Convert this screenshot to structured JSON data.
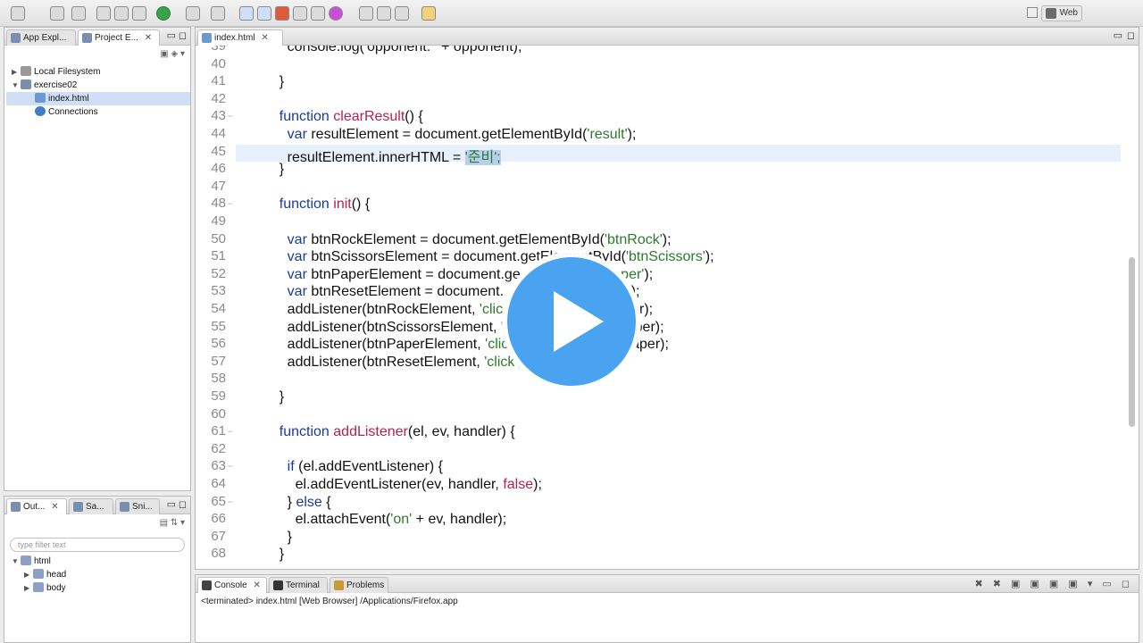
{
  "toolbar": {
    "perspective_label": "Web"
  },
  "left_top_panel": {
    "tabs": [
      {
        "label": "App Expl...",
        "icon": "folder-icon"
      },
      {
        "label": "Project E...",
        "icon": "project-icon"
      }
    ],
    "tree": [
      {
        "label": "Local Filesystem",
        "icon": "drive-icon",
        "twisty": "▶"
      },
      {
        "label": "exercise02",
        "icon": "project-icon",
        "twisty": "▼"
      },
      {
        "label": "index.html",
        "icon": "html-file-icon",
        "selected": true
      },
      {
        "label": "Connections",
        "icon": "globe-icon"
      }
    ]
  },
  "left_bottom_panel": {
    "tabs": [
      {
        "label": "Out...",
        "icon": "outline-icon"
      },
      {
        "label": "Sa...",
        "icon": "samples-icon"
      },
      {
        "label": "Sni...",
        "icon": "snippets-icon"
      }
    ],
    "filter_placeholder": "type filter text",
    "tree": [
      {
        "label": "html",
        "twisty": "▼"
      },
      {
        "label": "head",
        "twisty": "▶"
      },
      {
        "label": "body",
        "twisty": "▶"
      }
    ]
  },
  "editor": {
    "tab_label": "index.html",
    "lines": [
      {
        "n": "39",
        "tokens": [
          {
            "t": "      console.log('opponent: ' + opponent);",
            "c": ""
          }
        ]
      },
      {
        "n": "40",
        "tokens": [
          {
            "t": "",
            "c": ""
          }
        ]
      },
      {
        "n": "41",
        "tokens": [
          {
            "t": "    }",
            "c": ""
          }
        ]
      },
      {
        "n": "42",
        "tokens": [
          {
            "t": "",
            "c": ""
          }
        ]
      },
      {
        "n": "43",
        "fold": "−",
        "tokens": [
          {
            "t": "    function ",
            "c": "kw"
          },
          {
            "t": "clearResult",
            "c": "fn"
          },
          {
            "t": "() {",
            "c": ""
          }
        ]
      },
      {
        "n": "44",
        "tokens": [
          {
            "t": "      ",
            "c": ""
          },
          {
            "t": "var",
            "c": "kw"
          },
          {
            "t": " resultElement = document.getElementById(",
            "c": ""
          },
          {
            "t": "'result'",
            "c": "str"
          },
          {
            "t": ");",
            "c": ""
          }
        ]
      },
      {
        "n": "45",
        "highlight": true,
        "tokens": [
          {
            "t": "      resultElement.innerHTML = ",
            "c": ""
          },
          {
            "t": "'준비';",
            "c": "str sel"
          }
        ]
      },
      {
        "n": "46",
        "tokens": [
          {
            "t": "    }",
            "c": ""
          }
        ]
      },
      {
        "n": "47",
        "tokens": [
          {
            "t": "",
            "c": ""
          }
        ]
      },
      {
        "n": "48",
        "fold": "−",
        "tokens": [
          {
            "t": "    function ",
            "c": "kw"
          },
          {
            "t": "init",
            "c": "fn"
          },
          {
            "t": "() {",
            "c": ""
          }
        ]
      },
      {
        "n": "49",
        "tokens": [
          {
            "t": "",
            "c": ""
          }
        ]
      },
      {
        "n": "50",
        "tokens": [
          {
            "t": "      ",
            "c": ""
          },
          {
            "t": "var",
            "c": "kw"
          },
          {
            "t": " btnRockElement = document.getElementById(",
            "c": ""
          },
          {
            "t": "'btnRock'",
            "c": "str"
          },
          {
            "t": ");",
            "c": ""
          }
        ]
      },
      {
        "n": "51",
        "tokens": [
          {
            "t": "      ",
            "c": ""
          },
          {
            "t": "var",
            "c": "kw"
          },
          {
            "t": " btnScissorsElement = document.getElementById(",
            "c": ""
          },
          {
            "t": "'btnScissors'",
            "c": "str"
          },
          {
            "t": ");",
            "c": ""
          }
        ]
      },
      {
        "n": "52",
        "tokens": [
          {
            "t": "      ",
            "c": ""
          },
          {
            "t": "var",
            "c": "kw"
          },
          {
            "t": " btnPaperElement = document.ge",
            "c": ""
          },
          {
            "t": "            ",
            "c": ""
          },
          {
            "t": "d(",
            "c": ""
          },
          {
            "t": "'btnPaper'",
            "c": "str"
          },
          {
            "t": ");",
            "c": ""
          }
        ]
      },
      {
        "n": "53",
        "tokens": [
          {
            "t": "      ",
            "c": ""
          },
          {
            "t": "var",
            "c": "kw"
          },
          {
            "t": " btnResetElement = document.",
            "c": ""
          },
          {
            "t": "                 ",
            "c": ""
          },
          {
            "t": "btnReset'",
            "c": "str"
          },
          {
            "t": ");",
            "c": ""
          }
        ]
      },
      {
        "n": "54",
        "tokens": [
          {
            "t": "      addListener(btnRockElement, ",
            "c": ""
          },
          {
            "t": "'clic",
            "c": "str"
          },
          {
            "t": "                     orsPaper);",
            "c": ""
          }
        ]
      },
      {
        "n": "55",
        "tokens": [
          {
            "t": "      addListener(btnScissorsElement, '",
            "c": ""
          },
          {
            "t": "                    scorsPaper);",
            "c": ""
          }
        ]
      },
      {
        "n": "56",
        "tokens": [
          {
            "t": "      addListener(btnPaperElement, ",
            "c": ""
          },
          {
            "t": "'clic",
            "c": "str"
          },
          {
            "t": "                    ssorsPaper);",
            "c": ""
          }
        ]
      },
      {
        "n": "57",
        "tokens": [
          {
            "t": "      addListener(btnResetElement, ",
            "c": ""
          },
          {
            "t": "'click',",
            "c": "str"
          }
        ]
      },
      {
        "n": "58",
        "tokens": [
          {
            "t": "",
            "c": ""
          }
        ]
      },
      {
        "n": "59",
        "tokens": [
          {
            "t": "    }",
            "c": ""
          }
        ]
      },
      {
        "n": "60",
        "tokens": [
          {
            "t": "",
            "c": ""
          }
        ]
      },
      {
        "n": "61",
        "fold": "−",
        "tokens": [
          {
            "t": "    function ",
            "c": "kw"
          },
          {
            "t": "addListener",
            "c": "fn"
          },
          {
            "t": "(el, ev, handler) {",
            "c": ""
          }
        ]
      },
      {
        "n": "62",
        "tokens": [
          {
            "t": "",
            "c": ""
          }
        ]
      },
      {
        "n": "63",
        "fold": "−",
        "tokens": [
          {
            "t": "      ",
            "c": ""
          },
          {
            "t": "if",
            "c": "kw"
          },
          {
            "t": " (el.addEventListener) {",
            "c": ""
          }
        ]
      },
      {
        "n": "64",
        "tokens": [
          {
            "t": "        el.addEventListener(ev, handler, ",
            "c": ""
          },
          {
            "t": "false",
            "c": "fn"
          },
          {
            "t": ");",
            "c": ""
          }
        ]
      },
      {
        "n": "65",
        "fold": "−",
        "tokens": [
          {
            "t": "      } ",
            "c": ""
          },
          {
            "t": "else",
            "c": "kw"
          },
          {
            "t": " {",
            "c": ""
          }
        ]
      },
      {
        "n": "66",
        "tokens": [
          {
            "t": "        el.attachEvent(",
            "c": ""
          },
          {
            "t": "'on'",
            "c": "str"
          },
          {
            "t": " + ev, handler);",
            "c": ""
          }
        ]
      },
      {
        "n": "67",
        "tokens": [
          {
            "t": "      }",
            "c": ""
          }
        ]
      },
      {
        "n": "68",
        "tokens": [
          {
            "t": "    }",
            "c": ""
          }
        ]
      }
    ]
  },
  "console": {
    "tabs": [
      {
        "label": "Console",
        "icon": "console-icon",
        "close": "✕"
      },
      {
        "label": "Terminal",
        "icon": "terminal-icon"
      },
      {
        "label": "Problems",
        "icon": "problems-icon"
      }
    ],
    "status_text": "<terminated> index.html [Web Browser] /Applications/Firefox.app"
  },
  "colors": {
    "keyword": "#1a3a9e",
    "function_name": "#b4234f",
    "string": "#2d7a2d",
    "play_button": "#4aa3f0"
  },
  "overlay": {
    "icon": "play-icon"
  }
}
